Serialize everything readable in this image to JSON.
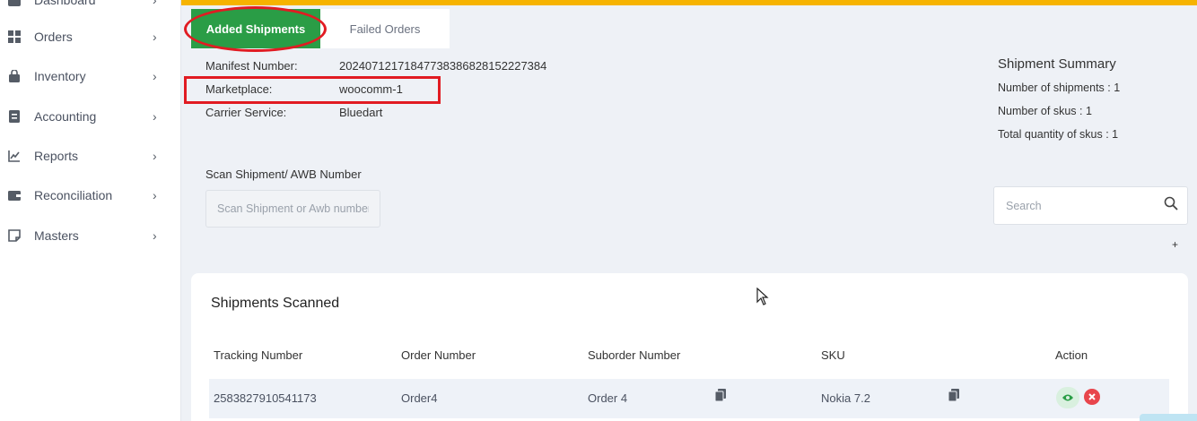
{
  "sidebar": {
    "items": [
      {
        "label": "Dashboard",
        "icon": "dashboard-icon"
      },
      {
        "label": "Orders",
        "icon": "grid-icon"
      },
      {
        "label": "Inventory",
        "icon": "bag-icon"
      },
      {
        "label": "Accounting",
        "icon": "ledger-icon"
      },
      {
        "label": "Reports",
        "icon": "chart-icon"
      },
      {
        "label": "Reconciliation",
        "icon": "wallet-icon"
      },
      {
        "label": "Masters",
        "icon": "note-icon"
      }
    ]
  },
  "tabs": {
    "added": "Added Shipments",
    "failed": "Failed Orders"
  },
  "manifest": {
    "manifest_label": "Manifest Number:",
    "manifest_value": "20240712171847738386828152227384",
    "marketplace_label": "Marketplace:",
    "marketplace_value": "woocomm-1",
    "carrier_label": "Carrier Service:",
    "carrier_value": "Bluedart"
  },
  "summary": {
    "title": "Shipment Summary",
    "shipments": "Number of shipments :  1",
    "skus": "Number of skus :  1",
    "total_qty": "Total quantity of skus : 1"
  },
  "scan": {
    "label": "Scan Shipment/ AWB Number",
    "placeholder": "Scan Shipment or Awb number"
  },
  "search": {
    "placeholder": "Search"
  },
  "plus_label": "+",
  "table": {
    "title": "Shipments Scanned",
    "headers": [
      "Tracking Number",
      "Order Number",
      "Suborder Number",
      "SKU",
      "Action"
    ],
    "rows": [
      {
        "tracking": "2583827910541173",
        "order": "Order4",
        "suborder": "Order 4",
        "sku": "Nokia 7.2"
      }
    ]
  },
  "colors": {
    "accent_yellow": "#f6b300",
    "tab_green": "#2a9d46",
    "annotation_red": "#e11b22",
    "delete_red": "#e8454c"
  }
}
